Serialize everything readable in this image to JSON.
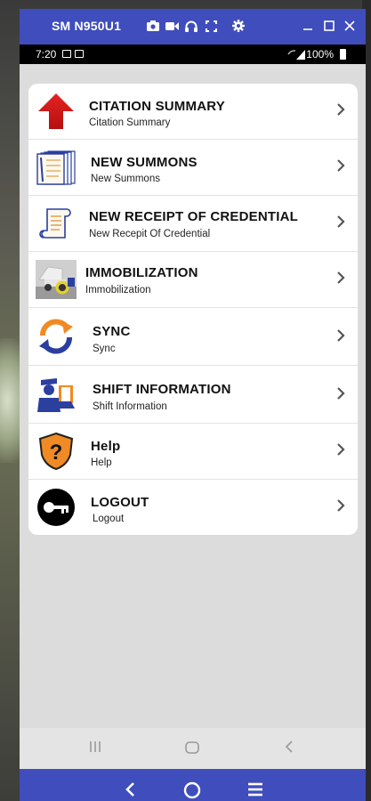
{
  "window": {
    "device_title": "SM N950U1"
  },
  "status_bar": {
    "time": "7:20",
    "battery": "100%"
  },
  "menu": [
    {
      "title": "CITATION SUMMARY",
      "subtitle": "Citation Summary",
      "icon": "red-arrow-up-icon"
    },
    {
      "title": "NEW SUMMONS",
      "subtitle": "New Summons",
      "icon": "summons-documents-icon"
    },
    {
      "title": "NEW RECEIPT OF CREDENTIAL",
      "subtitle": "New Recepit Of Credential",
      "icon": "receipt-scroll-icon"
    },
    {
      "title": "IMMOBILIZATION",
      "subtitle": "Immobilization",
      "icon": "immobilization-car-icon"
    },
    {
      "title": "SYNC",
      "subtitle": "Sync",
      "icon": "sync-arrows-icon"
    },
    {
      "title": "SHIFT INFORMATION",
      "subtitle": "Shift Information",
      "icon": "officer-shift-icon"
    },
    {
      "title": "Help",
      "subtitle": "Help",
      "icon": "question-shield-icon"
    },
    {
      "title": "LOGOUT",
      "subtitle": "Logout",
      "icon": "key-logout-icon"
    }
  ],
  "colors": {
    "titlebar": "#3f4dbd",
    "accent_orange": "#f08a24",
    "accent_blue": "#2a3f9e",
    "arrow_red": "#d71e1e"
  }
}
